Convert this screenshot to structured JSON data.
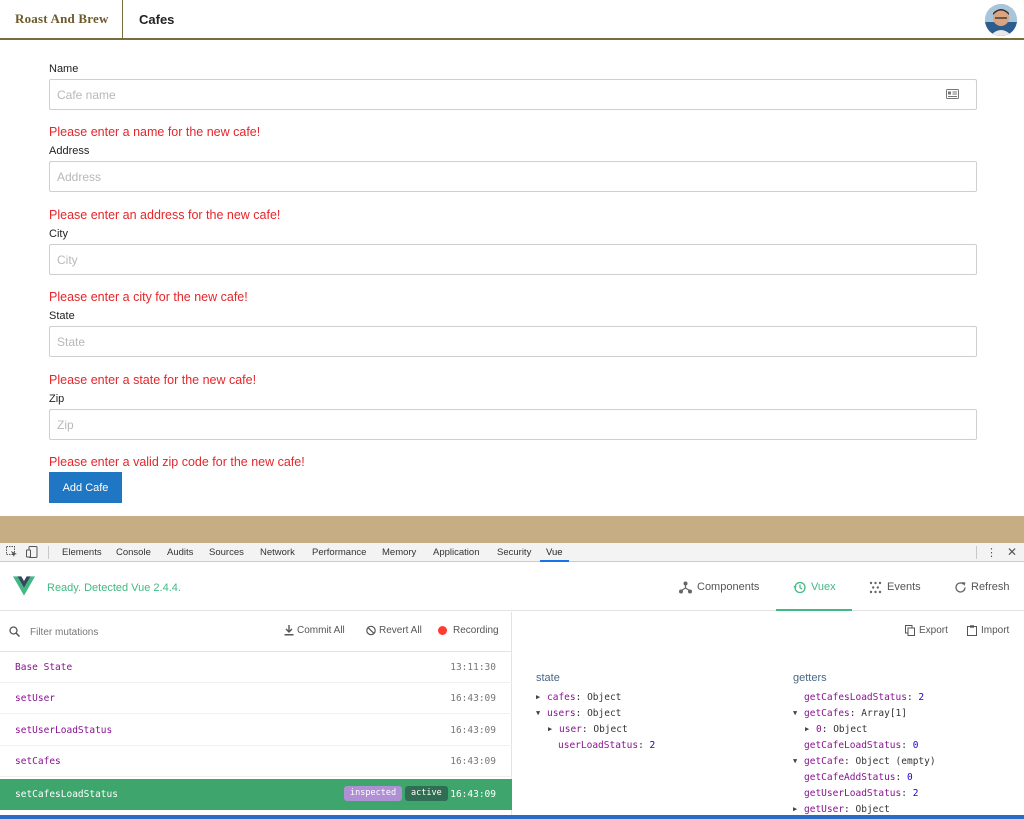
{
  "header": {
    "brand": "Roast And Brew",
    "nav_item": "Cafes"
  },
  "form": {
    "fields": [
      {
        "label": "Name",
        "placeholder": "Cafe name",
        "error": "Please enter a name for the new cafe!"
      },
      {
        "label": "Address",
        "placeholder": "Address",
        "error": "Please enter an address for the new cafe!"
      },
      {
        "label": "City",
        "placeholder": "City",
        "error": "Please enter a city for the new cafe!"
      },
      {
        "label": "State",
        "placeholder": "State",
        "error": "Please enter a state for the new cafe!"
      },
      {
        "label": "Zip",
        "placeholder": "Zip",
        "error": "Please enter a valid zip code for the new cafe!"
      }
    ],
    "submit_label": "Add Cafe"
  },
  "devtools": {
    "tabs": [
      "Elements",
      "Console",
      "Audits",
      "Sources",
      "Network",
      "Performance",
      "Memory",
      "Application",
      "Security",
      "Vue"
    ],
    "active_tab": "Vue"
  },
  "vue": {
    "status": "Ready. Detected Vue 2.4.4.",
    "nav": {
      "components": "Components",
      "vuex": "Vuex",
      "events": "Events",
      "refresh": "Refresh"
    },
    "toolbar": {
      "filter_placeholder": "Filter mutations",
      "commit_all": "Commit All",
      "revert_all": "Revert All",
      "recording": "Recording",
      "export": "Export",
      "import": "Import"
    },
    "mutations": [
      {
        "name": "Base State",
        "time": "13:11:30"
      },
      {
        "name": "setUser",
        "time": "16:43:09"
      },
      {
        "name": "setUserLoadStatus",
        "time": "16:43:09"
      },
      {
        "name": "setCafes",
        "time": "16:43:09"
      },
      {
        "name": "setCafesLoadStatus",
        "time": "16:43:09",
        "badges": [
          "inspected",
          "active"
        ]
      }
    ],
    "state": {
      "title": "state",
      "lines": [
        {
          "key": "cafes",
          "value": "Object"
        },
        {
          "key": "users",
          "value": "Object"
        },
        {
          "key": "user",
          "value": "Object"
        },
        {
          "key": "userLoadStatus",
          "value": "2"
        }
      ]
    },
    "getters": {
      "title": "getters",
      "lines": [
        {
          "key": "getCafesLoadStatus",
          "value": "2"
        },
        {
          "key": "getCafes",
          "value": "Array[1]"
        },
        {
          "key": "0",
          "value": "Object"
        },
        {
          "key": "getCafeLoadStatus",
          "value": "0"
        },
        {
          "key": "getCafe",
          "value": "Object (empty)"
        },
        {
          "key": "getCafeAddStatus",
          "value": "0"
        },
        {
          "key": "getUserLoadStatus",
          "value": "2"
        },
        {
          "key": "getUser",
          "value": "Object"
        }
      ]
    }
  },
  "colors": {
    "brand": "#6b5a2a",
    "error": "#e5262a",
    "primary_button": "#1f76c2",
    "vue_green": "#42b983",
    "selected_row": "#3ea56c"
  }
}
